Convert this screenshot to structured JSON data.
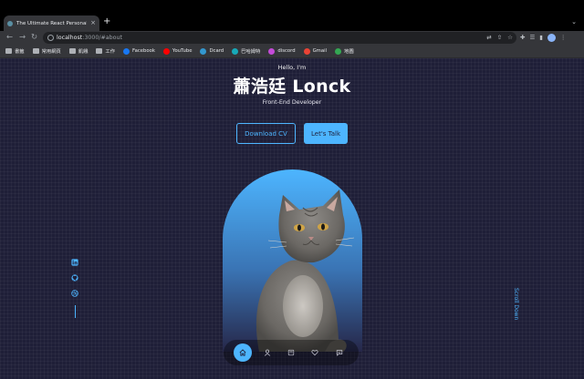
{
  "browser": {
    "tab_title": "The Ultimate React Personal P",
    "tab_close": "×",
    "new_tab": "+",
    "url_host": "localhost",
    "url_rest": ":3000/#about",
    "bookmarks": [
      {
        "label": "書籤",
        "icon": "folder-icon"
      },
      {
        "label": "常用網頁",
        "icon": "folder-icon"
      },
      {
        "label": "飢餓",
        "icon": "folder-icon"
      },
      {
        "label": "工作",
        "icon": "folder-icon"
      },
      {
        "label": "Facebook",
        "icon": "facebook-icon",
        "color": "#1877f2"
      },
      {
        "label": "YouTube",
        "icon": "youtube-icon",
        "color": "#ff0000"
      },
      {
        "label": "Dcard",
        "icon": "dcard-icon",
        "color": "#3397cf"
      },
      {
        "label": "巴哈姆特",
        "icon": "bahamut-icon",
        "color": "#17a9b8"
      },
      {
        "label": "discord",
        "icon": "discord-icon",
        "color": "#c44bd8"
      },
      {
        "label": "Gmail",
        "icon": "gmail-icon",
        "color": "#ea4335"
      },
      {
        "label": "地圖",
        "icon": "maps-icon",
        "color": "#34a853"
      }
    ]
  },
  "hero": {
    "greeting": "Hello, I'm",
    "name": "蕭浩廷 Lonck",
    "role": "Front-End Developer",
    "download_cv": "Download CV",
    "lets_talk": "Let's Talk",
    "scroll_down": "Scroll Down"
  },
  "socials": [
    "linkedin-icon",
    "github-icon",
    "dribbble-icon"
  ],
  "nav": {
    "items": [
      "home-icon",
      "user-icon",
      "book-icon",
      "services-icon",
      "message-icon"
    ],
    "active": "home-icon"
  },
  "colors": {
    "page_bg": "#1f1f38",
    "accent": "#4db5ff",
    "chrome": "#35363a"
  }
}
